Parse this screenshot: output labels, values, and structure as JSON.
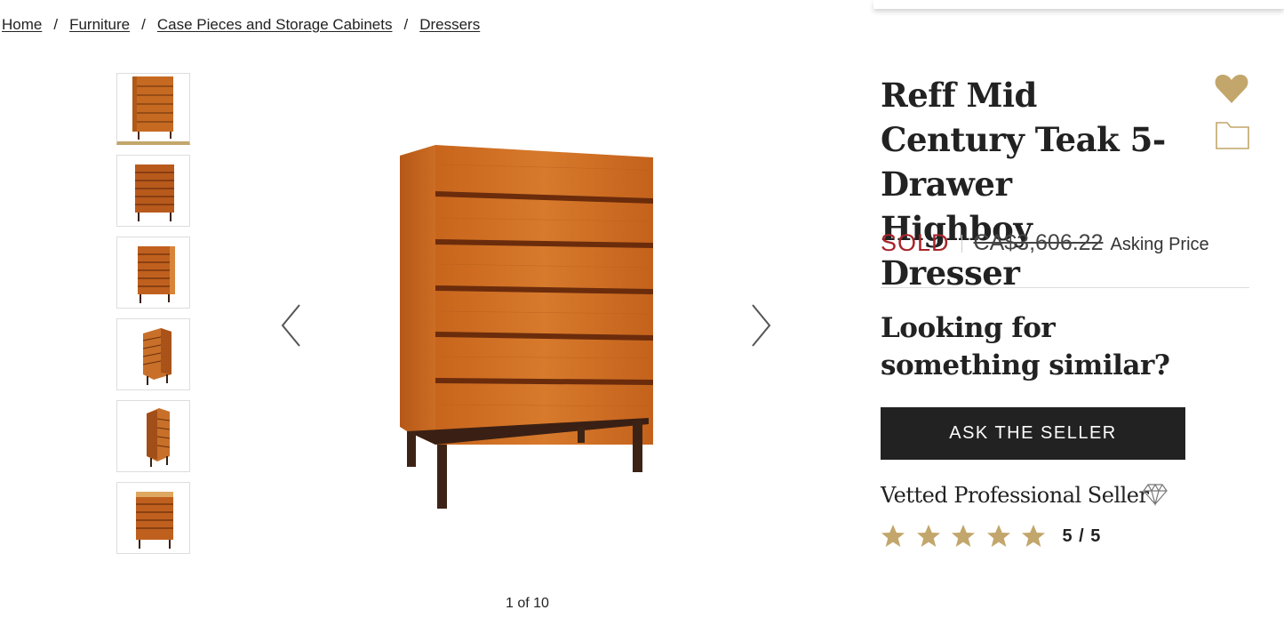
{
  "breadcrumb": {
    "items": [
      "Home",
      "Furniture",
      "Case Pieces and Storage Cabinets",
      "Dressers"
    ],
    "separator": "/"
  },
  "gallery": {
    "counter": "1 of 10",
    "thumbnail_count": 6
  },
  "product": {
    "title": "Reff Mid Century Teak 5-Drawer Highboy Dresser",
    "status": "SOLD",
    "price": "CA$3,606.22",
    "price_label": "Asking Price"
  },
  "similar": {
    "heading": "Looking for something similar?",
    "button_label": "ASK THE SELLER"
  },
  "seller": {
    "badge_text": "Vetted Professional Seller",
    "rating_text": "5 / 5",
    "rating": 5,
    "rating_max": 5
  },
  "icons": {
    "favorite": "heart-icon",
    "save": "folder-icon",
    "prev": "chevron-left-icon",
    "next": "chevron-right-icon",
    "vetted": "diamond-icon",
    "star": "star-icon"
  },
  "colors": {
    "accent_gold": "#c2a66b",
    "sold_red": "#a8242a",
    "button_dark": "#222222",
    "teak": "#c2611a"
  }
}
